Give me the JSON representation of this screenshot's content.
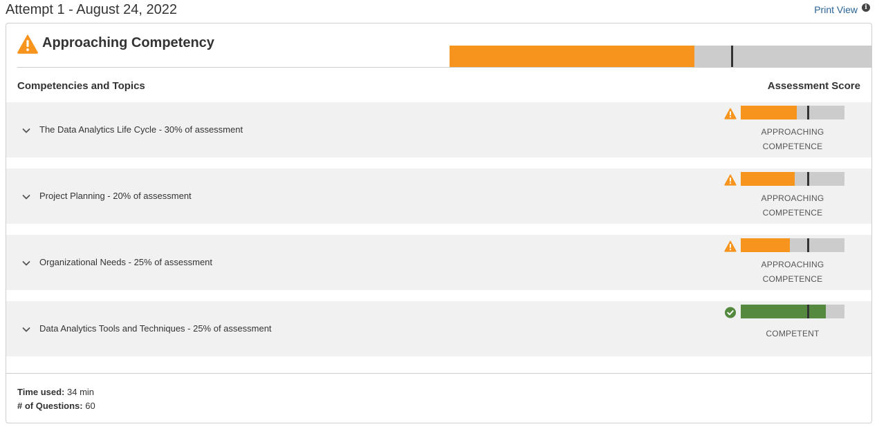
{
  "attempt": {
    "title": "Attempt 1 - August 24, 2022"
  },
  "print": {
    "label": "Print View",
    "info_icon": "info-icon"
  },
  "overall": {
    "status": "Approaching Competency",
    "icon": "warning-icon",
    "score_fraction": 0.58,
    "threshold_fraction": 0.668
  },
  "columns": {
    "left": "Competencies and Topics",
    "right": "Assessment Score"
  },
  "topics": [
    {
      "label": "The Data Analytics Life Cycle - 30% of assessment",
      "level_line1": "APPROACHING",
      "level_line2": "COMPETENCE",
      "status": "warning",
      "score_fraction": 0.54,
      "threshold_fraction": 0.65
    },
    {
      "label": "Project Planning - 20% of assessment",
      "level_line1": "APPROACHING",
      "level_line2": "COMPETENCE",
      "status": "warning",
      "score_fraction": 0.52,
      "threshold_fraction": 0.65
    },
    {
      "label": "Organizational Needs - 25% of assessment",
      "level_line1": "APPROACHING",
      "level_line2": "COMPETENCE",
      "status": "warning",
      "score_fraction": 0.47,
      "threshold_fraction": 0.65
    },
    {
      "label": "Data Analytics Tools and Techniques - 25% of assessment",
      "level_line1": "COMPETENT",
      "level_line2": "",
      "status": "competent",
      "score_fraction": 0.82,
      "threshold_fraction": 0.65
    }
  ],
  "footer": {
    "time_label": "Time used:",
    "time_value": "34 min",
    "questions_label": "# of Questions:",
    "questions_value": "60"
  },
  "colors": {
    "warning": "#f7941d",
    "competent": "#54893f",
    "track": "#cccccc",
    "marker": "#333333",
    "link": "#2a6496"
  }
}
